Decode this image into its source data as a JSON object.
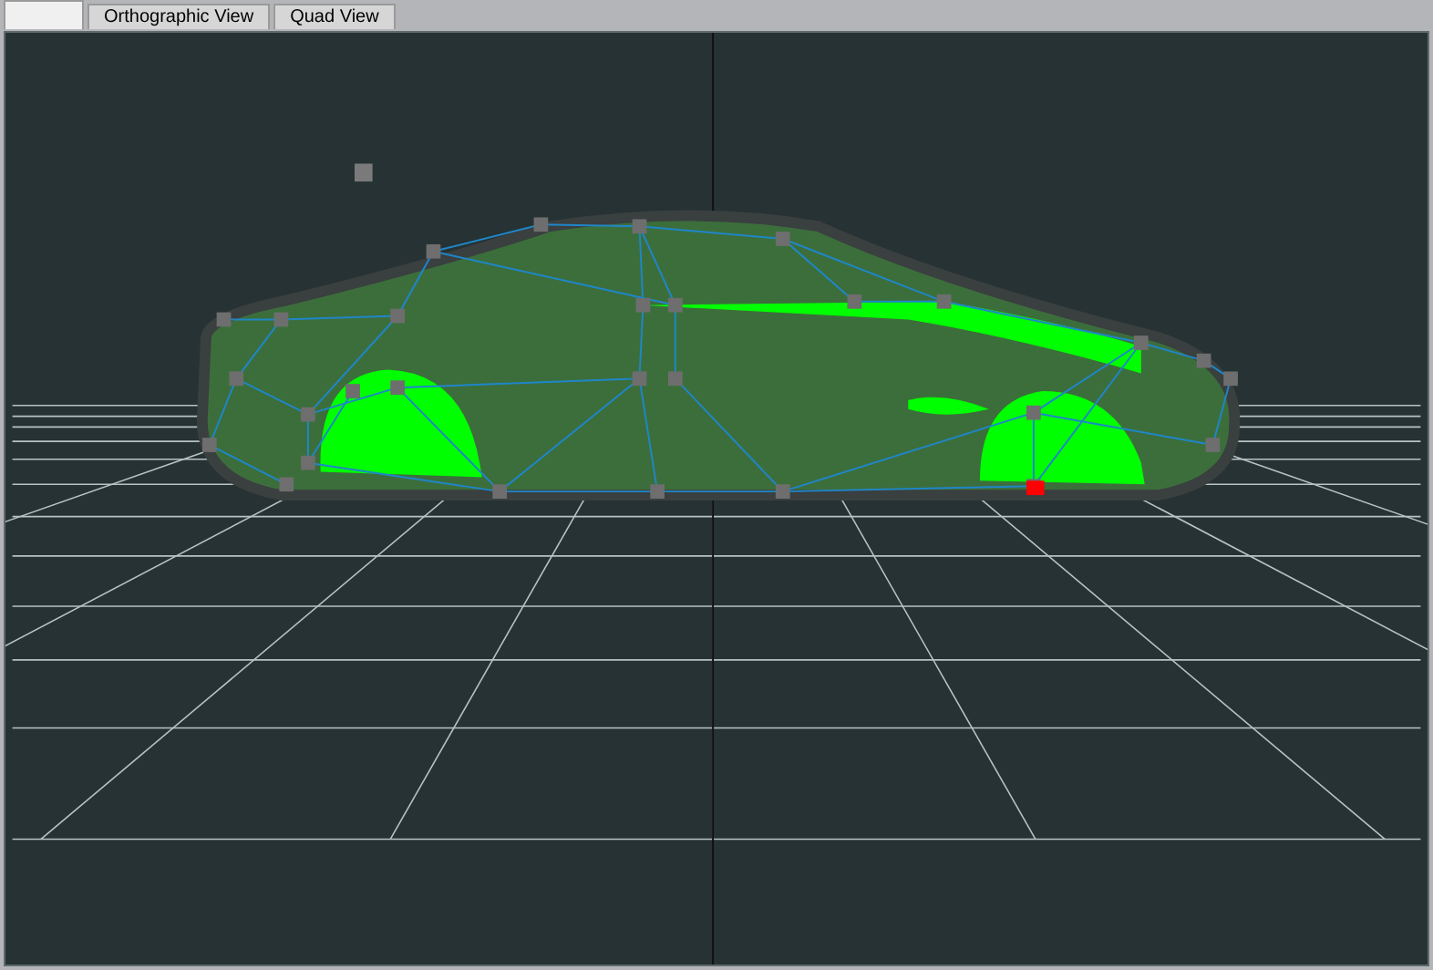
{
  "tabs": [
    {
      "selected": true
    },
    {
      "label": "Orthographic View",
      "selected": false
    },
    {
      "label": "Quad View",
      "selected": false
    }
  ]
}
